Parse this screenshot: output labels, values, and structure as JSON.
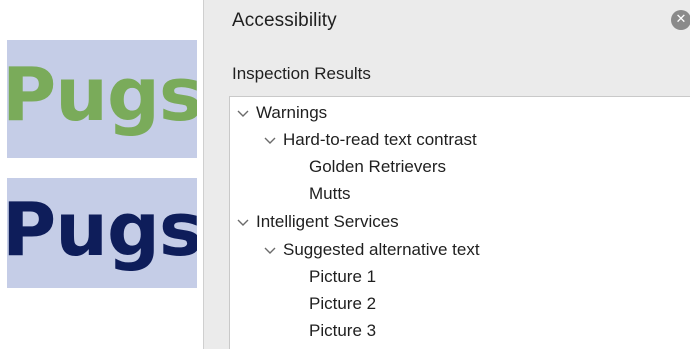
{
  "slides": [
    {
      "text": "Pugs",
      "text_color": "#7aab5a",
      "background": "#c5cde7"
    },
    {
      "text": "Pugs",
      "text_color": "#0e1d5a",
      "background": "#c5cde7"
    }
  ],
  "pane": {
    "title": "Accessibility",
    "close_icon": "close-circle-icon",
    "section_label": "Inspection Results",
    "tree": {
      "warnings": {
        "label": "Warnings",
        "group": {
          "label": "Hard-to-read text contrast",
          "items": [
            "Golden Retrievers",
            "Mutts"
          ]
        }
      },
      "intelligent": {
        "label": "Intelligent Services",
        "group": {
          "label": "Suggested alternative text",
          "items": [
            "Picture 1",
            "Picture 2",
            "Picture 3"
          ]
        }
      }
    }
  }
}
